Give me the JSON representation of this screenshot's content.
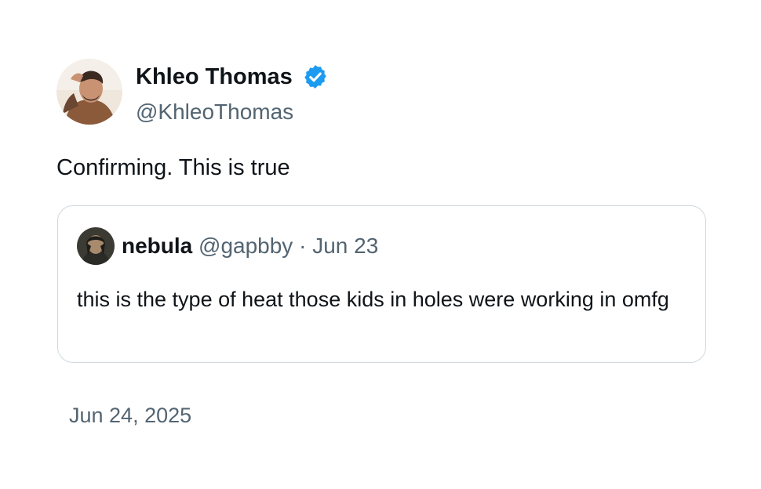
{
  "tweet": {
    "author": {
      "name": "Khleo Thomas",
      "handle": "@KhleoThomas",
      "verified": true,
      "avatar_icon": "profile-photo"
    },
    "text": "Confirming. This is true",
    "timestamp": "Jun 24, 2025"
  },
  "quoted_tweet": {
    "author_name": "nebula",
    "handle": "@gapbby",
    "separator": "·",
    "date": "Jun 23",
    "avatar_icon": "profile-photo",
    "text": "this is the type of heat those kids in holes were working in omfg"
  },
  "colors": {
    "primary_text": "#0f1419",
    "secondary_text": "#536471",
    "verified_blue": "#1d9bf0",
    "card_border": "#cfd9de"
  }
}
